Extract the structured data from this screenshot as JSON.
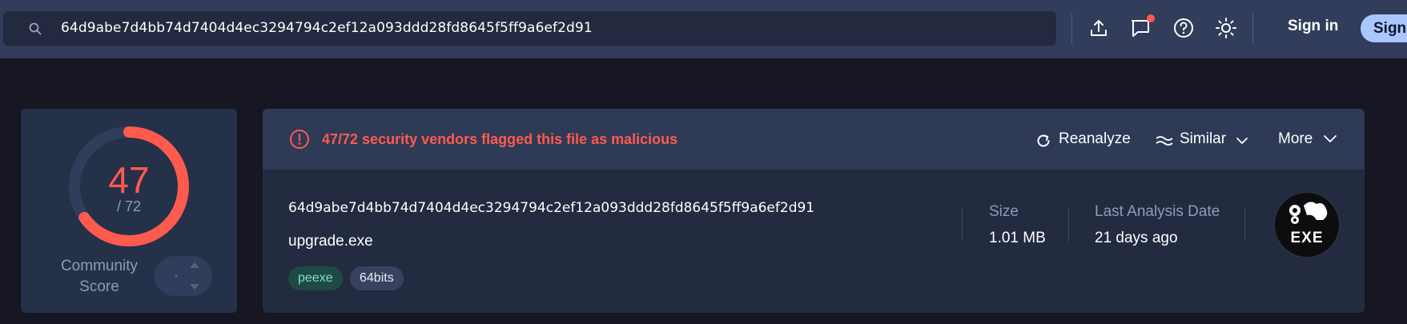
{
  "search": {
    "value": "64d9abe7d4bb74d7404d4ec3294794c2ef12a093ddd28fd8645f5ff9a6ef2d91",
    "icon": "search-icon"
  },
  "header": {
    "icons": [
      "upload-icon",
      "chat-icon",
      "help-icon",
      "theme-icon"
    ],
    "notification_color": "#ff5a4e",
    "sign_in_label": "Sign in",
    "sign_up_label": "Sign"
  },
  "score": {
    "detections": "47",
    "total": "/ 72",
    "fraction": 0.6528,
    "ring_color": "#ff5a4e",
    "community_label_line1": "Community",
    "community_label_line2": "Score"
  },
  "alert": {
    "text": "47/72 security vendors flagged this file as malicious",
    "color": "#ff5a4e"
  },
  "actions": {
    "reanalyze_label": "Reanalyze",
    "similar_label": "Similar",
    "more_label": "More"
  },
  "file": {
    "hash": "64d9abe7d4bb74d7404d4ec3294794c2ef12a093ddd28fd8645f5ff9a6ef2d91",
    "name": "upgrade.exe",
    "tags": [
      "peexe",
      "64bits"
    ],
    "size_label": "Size",
    "size_value": "1.01 MB",
    "date_label": "Last Analysis Date",
    "date_value": "21 days ago",
    "type_badge": "EXE"
  }
}
